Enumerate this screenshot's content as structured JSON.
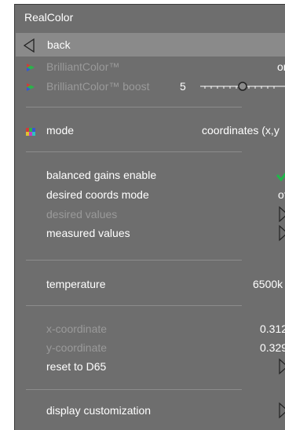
{
  "title": "RealColor",
  "back": {
    "label": "back"
  },
  "brilliantcolor": {
    "label": "BrilliantColor™",
    "value": "on"
  },
  "brilliantcolor_boost": {
    "label": "BrilliantColor™ boost",
    "value": "5",
    "level": 5
  },
  "mode": {
    "label": "mode",
    "value": "coordinates (x,y"
  },
  "balanced_gains": {
    "label": "balanced gains enable",
    "checked": true
  },
  "desired_coords_mode": {
    "label": "desired coords mode",
    "value": "of"
  },
  "desired_values": {
    "label": "desired values"
  },
  "measured_values": {
    "label": "measured values"
  },
  "temperature": {
    "label": "temperature",
    "value": "6500k"
  },
  "x_coordinate": {
    "label": "x-coordinate",
    "value": "0.312"
  },
  "y_coordinate": {
    "label": "y-coordinate",
    "value": "0.329"
  },
  "reset": {
    "label": "reset to D65"
  },
  "display_customization": {
    "label": "display customization"
  },
  "colors": {
    "panel": "#6e6e6e",
    "highlight": "#8a8a8a",
    "check": "#1fb84a",
    "disabled_text": "#9a9a9a"
  }
}
